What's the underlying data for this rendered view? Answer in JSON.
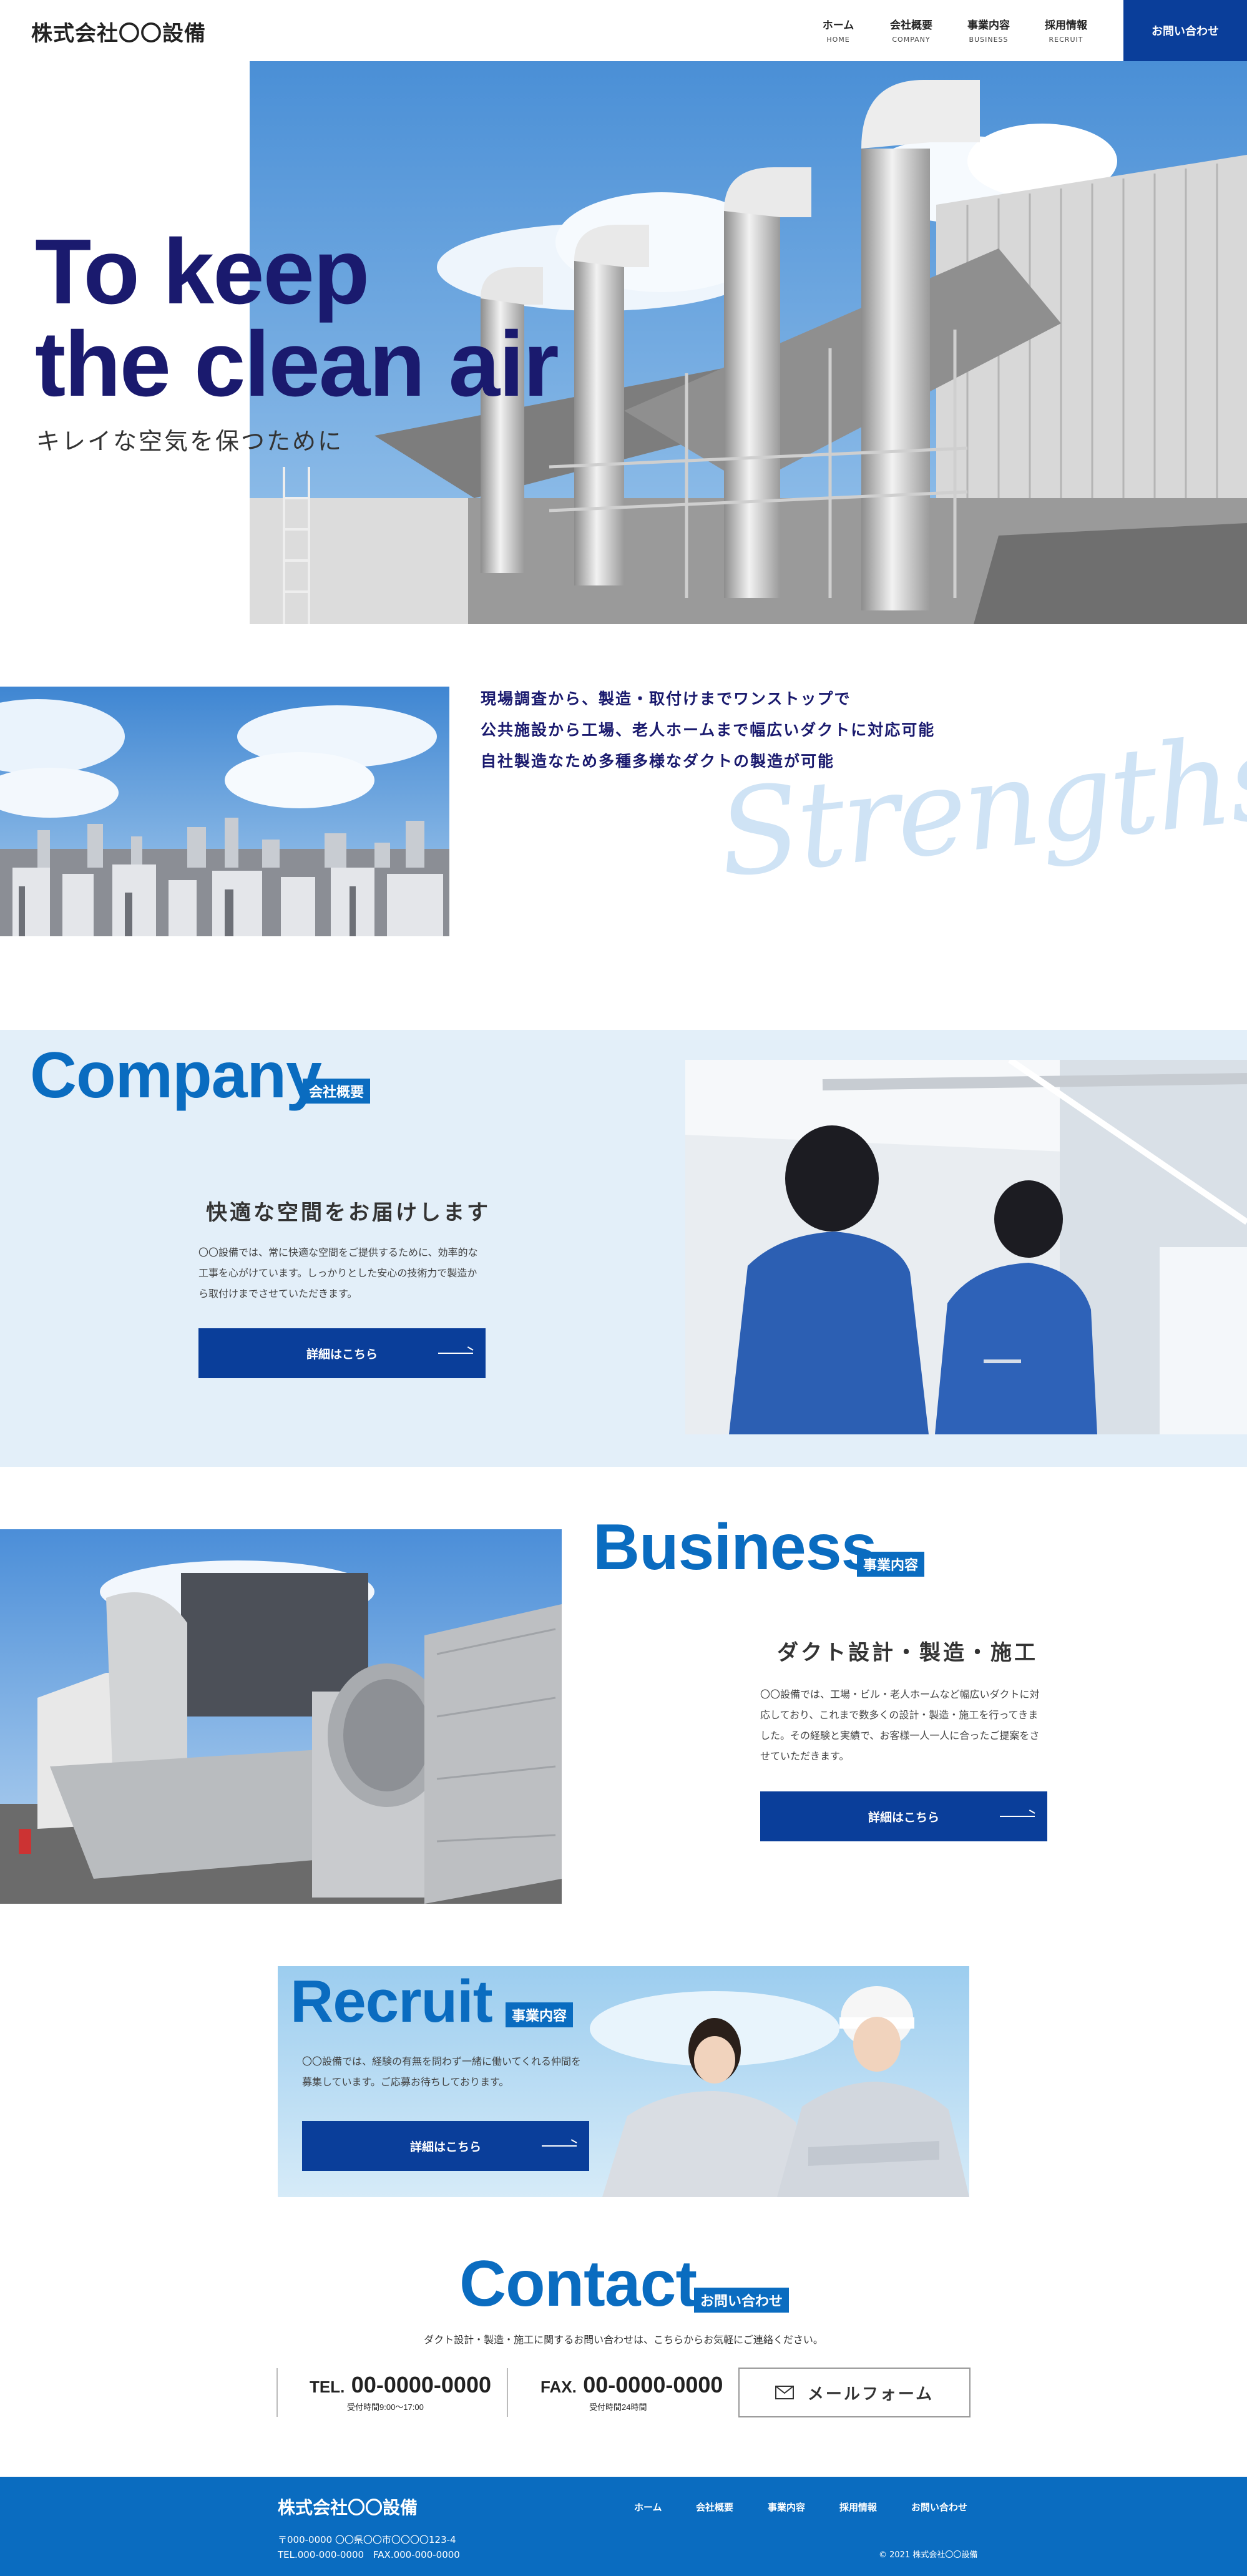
{
  "header": {
    "logo": "株式会社〇〇設備",
    "nav": [
      {
        "jp": "ホーム",
        "en": "HOME"
      },
      {
        "jp": "会社概要",
        "en": "COMPANY"
      },
      {
        "jp": "事業内容",
        "en": "BUSINESS"
      },
      {
        "jp": "採用情報",
        "en": "RECRUIT"
      }
    ],
    "contact_label": "お問い合わせ"
  },
  "hero": {
    "title_line1": "To keep",
    "title_line2": "the clean air",
    "subtitle": "キレイな空気を保つために"
  },
  "strengths": {
    "lines": [
      "現場調査から、製造・取付けまでワンストップで",
      "公共施設から工場、老人ホームまで幅広いダクトに対応可能",
      "自社製造なため多種多様なダクトの製造が可能"
    ],
    "script": "Strengths"
  },
  "company": {
    "title": "Company",
    "tag": "会社概要",
    "heading": "快適な空間をお届けします",
    "body": [
      "〇〇設備では、常に快適な空間をご提供するために、効率的な",
      "工事を心がけています。しっかりとした安心の技術力で製造か",
      "ら取付けまでさせていただきます。"
    ],
    "button": "詳細はこちら"
  },
  "business": {
    "title": "Business",
    "tag": "事業内容",
    "heading": "ダクト設計・製造・施工",
    "body": [
      "〇〇設備では、工場・ビル・老人ホームなど幅広いダクトに対",
      "応しており、これまで数多くの設計・製造・施工を行ってきま",
      "した。その経験と実績で、お客様一人一人に合ったご提案をさ",
      "せていただきます。"
    ],
    "button": "詳細はこちら"
  },
  "recruit": {
    "title": "Recruit",
    "tag": "事業内容",
    "body": [
      "〇〇設備では、経験の有無を問わず一緒に働いてくれる仲間を",
      "募集しています。ご応募お待ちしております。"
    ],
    "button": "詳細はこちら"
  },
  "contact": {
    "title": "Contact",
    "tag": "お問い合わせ",
    "lead": "ダクト設計・製造・施工に関するお問い合わせは、こちらからお気軽にご連絡ください。",
    "tel_label": "TEL.",
    "tel_number": "00-0000-0000",
    "tel_hours": "受付時間9:00〜17:00",
    "fax_label": "FAX.",
    "fax_number": "00-0000-0000",
    "fax_hours": "受付時間24時間",
    "mail_button": "メールフォーム"
  },
  "footer": {
    "logo": "株式会社〇〇設備",
    "nav": [
      "ホーム",
      "会社概要",
      "事業内容",
      "採用情報",
      "お問い合わせ"
    ],
    "address": "〒000-0000 〇〇県〇〇市〇〇〇〇123-4",
    "telfax": "TEL.000-000-0000　FAX.000-000-0000",
    "copyright": "© 2021 株式会社〇〇設備"
  },
  "colors": {
    "navy": "#1a1a6e",
    "brand_blue": "#0a6cc0",
    "button_blue": "#0a3e9a",
    "light_bg": "#e3eff9"
  }
}
